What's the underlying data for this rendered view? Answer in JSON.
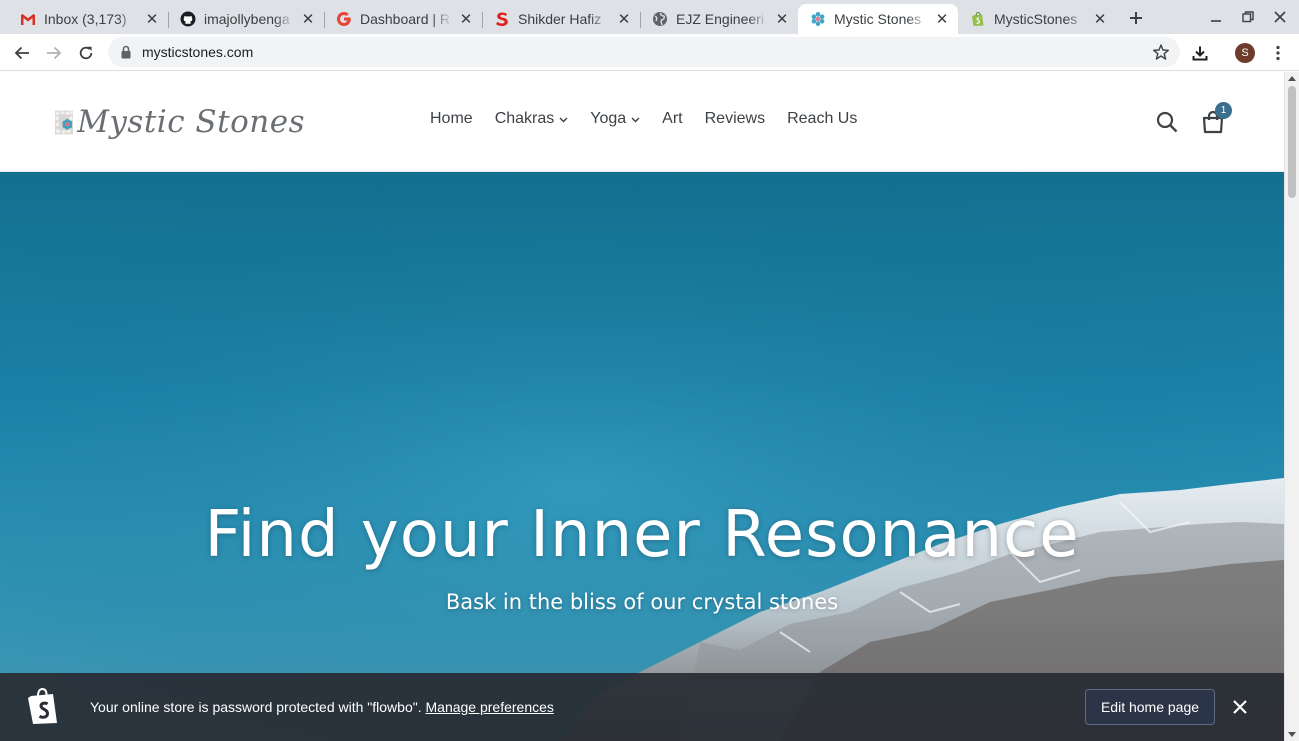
{
  "browser": {
    "tabs": [
      {
        "title": "Inbox (3,173)",
        "icon": "gmail-icon",
        "active": false
      },
      {
        "title": "imajollybenga",
        "icon": "github-icon",
        "active": false
      },
      {
        "title": "Dashboard | R",
        "icon": "g-icon",
        "active": false
      },
      {
        "title": "Shikder Hafiz",
        "icon": "s-red-icon",
        "active": false
      },
      {
        "title": "EJZ Engineeri",
        "icon": "globe-icon",
        "active": false
      },
      {
        "title": "Mystic Stones",
        "icon": "mystic-stones-favicon",
        "active": true
      },
      {
        "title": "MysticStones",
        "icon": "shopify-icon",
        "active": false
      }
    ],
    "url": "mysticstones.com",
    "profile_initial": "S"
  },
  "site": {
    "logo_text": "Mystic Stones",
    "nav": [
      {
        "label": "Home",
        "has_dropdown": false
      },
      {
        "label": "Chakras",
        "has_dropdown": true
      },
      {
        "label": "Yoga",
        "has_dropdown": true
      },
      {
        "label": "Art",
        "has_dropdown": false
      },
      {
        "label": "Reviews",
        "has_dropdown": false
      },
      {
        "label": "Reach Us",
        "has_dropdown": false
      }
    ],
    "cart_count": "1",
    "hero": {
      "title": "Find your Inner Resonance",
      "subtitle": "Bask in the bliss of our crystal stones"
    }
  },
  "notice": {
    "message": "Your online store is password protected with \"flowbo\".",
    "link": "Manage preferences",
    "button": "Edit home page"
  },
  "colors": {
    "tab_strip": "#dee1e6",
    "sky": "#1b82a8",
    "notice_bg": "#282c34",
    "cart_badge": "#3a6f8e"
  }
}
